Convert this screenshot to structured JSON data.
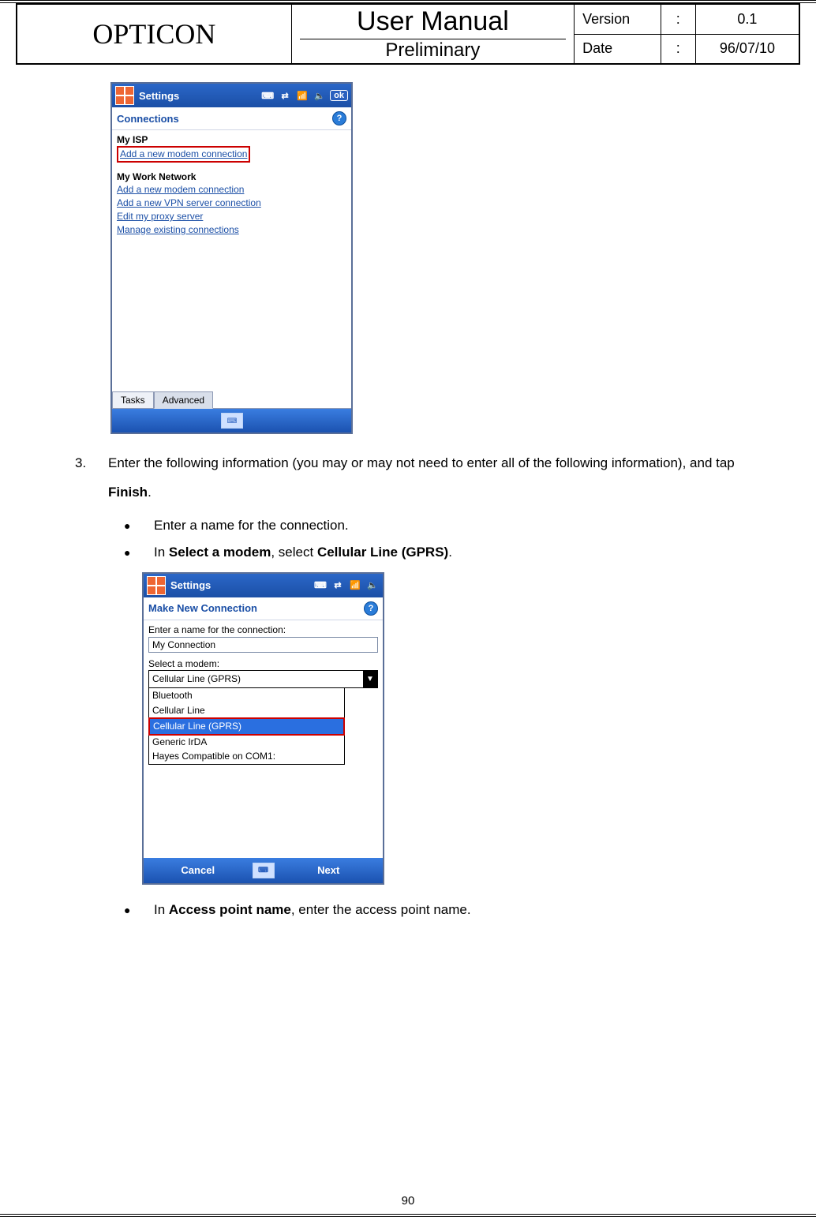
{
  "header": {
    "brand": "OPTICON",
    "title": "User Manual",
    "subtitle": "Preliminary",
    "kv": [
      {
        "label": "Version",
        "colon": ":",
        "value": "0.1"
      },
      {
        "label": "Date",
        "colon": ":",
        "value": "96/07/10"
      }
    ]
  },
  "screenshot1": {
    "title": "Settings",
    "ok": "ok",
    "subtitle": "Connections",
    "group1": "My ISP",
    "group1_link": "Add a new modem connection",
    "group2": "My Work Network",
    "group2_links": [
      "Add a new modem connection",
      "Add a new VPN server connection",
      "Edit my proxy server",
      "Manage existing connections"
    ],
    "tabs": {
      "tasks": "Tasks",
      "advanced": "Advanced"
    },
    "kbd": "⌨"
  },
  "step3": {
    "num": "3.",
    "text_pre": "Enter the following information (you may or may not need to enter all of the following information), and tap ",
    "text_bold": "Finish",
    "text_post": "."
  },
  "bullet1": {
    "dot": "●",
    "text": "Enter a name for the connection."
  },
  "bullet2": {
    "dot": "●",
    "pre": "In ",
    "b1": "Select a modem",
    "mid": ", select ",
    "b2": "Cellular Line (GPRS)",
    "post": "."
  },
  "screenshot2": {
    "title": "Settings",
    "subtitle": "Make New Connection",
    "label1": "Enter a name for the connection:",
    "input1": "My Connection",
    "label2": "Select a modem:",
    "combo_value": "Cellular Line (GPRS)",
    "list": [
      "Bluetooth",
      "Cellular Line",
      "Cellular Line (GPRS)",
      "Generic IrDA",
      "Hayes Compatible on COM1:"
    ],
    "cancel": "Cancel",
    "next": "Next",
    "kbd": "⌨"
  },
  "bullet3": {
    "dot": "●",
    "pre": "In ",
    "b1": "Access point name",
    "post": ", enter the access point name."
  },
  "page_number": "90"
}
